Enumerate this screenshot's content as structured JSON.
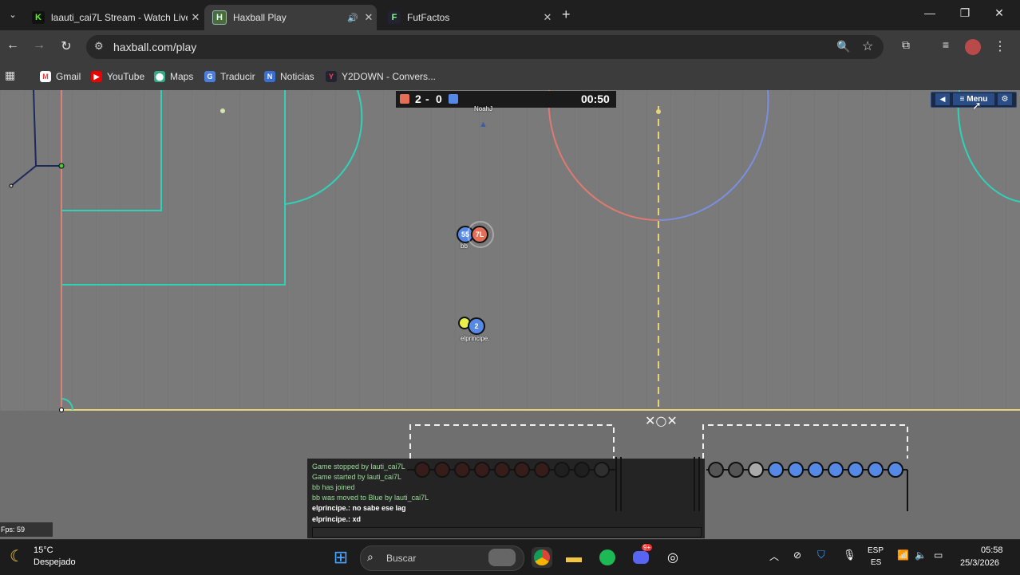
{
  "browser": {
    "tabs": [
      {
        "title": "laauti_cai7L Stream - Watch Live",
        "icon": "kick-icon",
        "icon_color": "#53fc18",
        "active": false
      },
      {
        "title": "Haxball Play",
        "icon": "haxball-icon",
        "active": true
      },
      {
        "title": "FutFactos",
        "icon": "futfactos-icon",
        "active": false
      }
    ],
    "url": "haxball.com/play",
    "bookmarks": [
      {
        "label": "Gmail",
        "icon": "gmail-icon"
      },
      {
        "label": "YouTube",
        "icon": "youtube-icon"
      },
      {
        "label": "Maps",
        "icon": "maps-icon"
      },
      {
        "label": "Traducir",
        "icon": "translate-icon"
      },
      {
        "label": "Noticias",
        "icon": "news-icon"
      },
      {
        "label": "Y2DOWN - Convers...",
        "icon": "y2down-icon"
      }
    ]
  },
  "game": {
    "score": {
      "red": "2",
      "separator": "-",
      "blue": "0",
      "time": "00:50",
      "red_color": "#e56e56",
      "blue_color": "#5689e5"
    },
    "menu_label": "Menu",
    "players": [
      {
        "label": "55",
        "team": "blue",
        "name": "bb"
      },
      {
        "label": "7L",
        "team": "red",
        "name": ""
      },
      {
        "label": "2",
        "team": "blue",
        "name": "elprincipe."
      },
      {
        "label": "",
        "team": "blue",
        "name": "NoahJ"
      }
    ],
    "chat": [
      {
        "text": "Game stopped by lauti_cai7L",
        "style": "notice"
      },
      {
        "text": "Game started by lauti_cai7L",
        "style": "notice"
      },
      {
        "text": "bb has joined",
        "style": "notice"
      },
      {
        "text": "bb was moved to Blue by lauti_cai7L",
        "style": "notice"
      },
      {
        "text": "elprincipe.: no sabe ese lag",
        "style": "message"
      },
      {
        "text": "elprincipe.: xd",
        "style": "message"
      }
    ],
    "fps": "Fps: 59"
  },
  "taskbar": {
    "weather_temp": "15°C",
    "weather_desc": "Despejado",
    "search_placeholder": "Buscar",
    "lang_top": "ESP",
    "lang_bottom": "ES",
    "time": "05:58",
    "date": "25/3/2026",
    "discord_badge": "9+"
  },
  "colors": {
    "red_team": "#e56e56",
    "blue_team": "#5689e5",
    "ball": "#e8f04a",
    "field_line": "#2fd2b8"
  }
}
